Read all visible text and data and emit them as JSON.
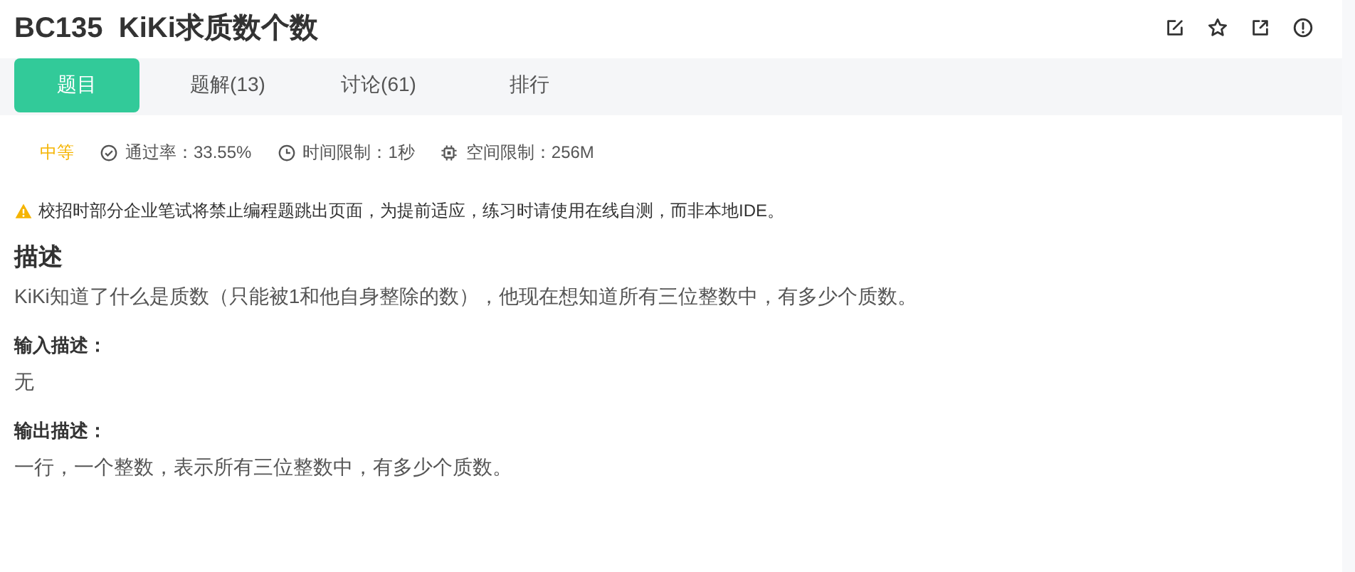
{
  "title": "BC135  KiKi求质数个数",
  "tabs": [
    {
      "label": "题目",
      "selected": true
    },
    {
      "label": "题解(13)",
      "selected": false
    },
    {
      "label": "讨论(61)",
      "selected": false
    },
    {
      "label": "排行",
      "selected": false
    }
  ],
  "difficulty": "中等",
  "stats": [
    {
      "kind": "pass",
      "text": "通过率：33.55%"
    },
    {
      "kind": "time",
      "text": "时间限制：1秒"
    },
    {
      "kind": "memory",
      "text": "空间限制：256M"
    }
  ],
  "notice": "校招时部分企业笔试将禁止编程题跳出页面，为提前适应，练习时请使用在线自测，而非本地IDE。",
  "description": {
    "heading": "描述",
    "text": "KiKi知道了什么是质数（只能被1和他自身整除的数），他现在想知道所有三位整数中，有多少个质数。"
  },
  "sections": [
    {
      "heading": "输入描述：",
      "text": "无"
    },
    {
      "heading": "输出描述：",
      "text": "一行，一个整数，表示所有三位整数中，有多少个质数。"
    }
  ]
}
